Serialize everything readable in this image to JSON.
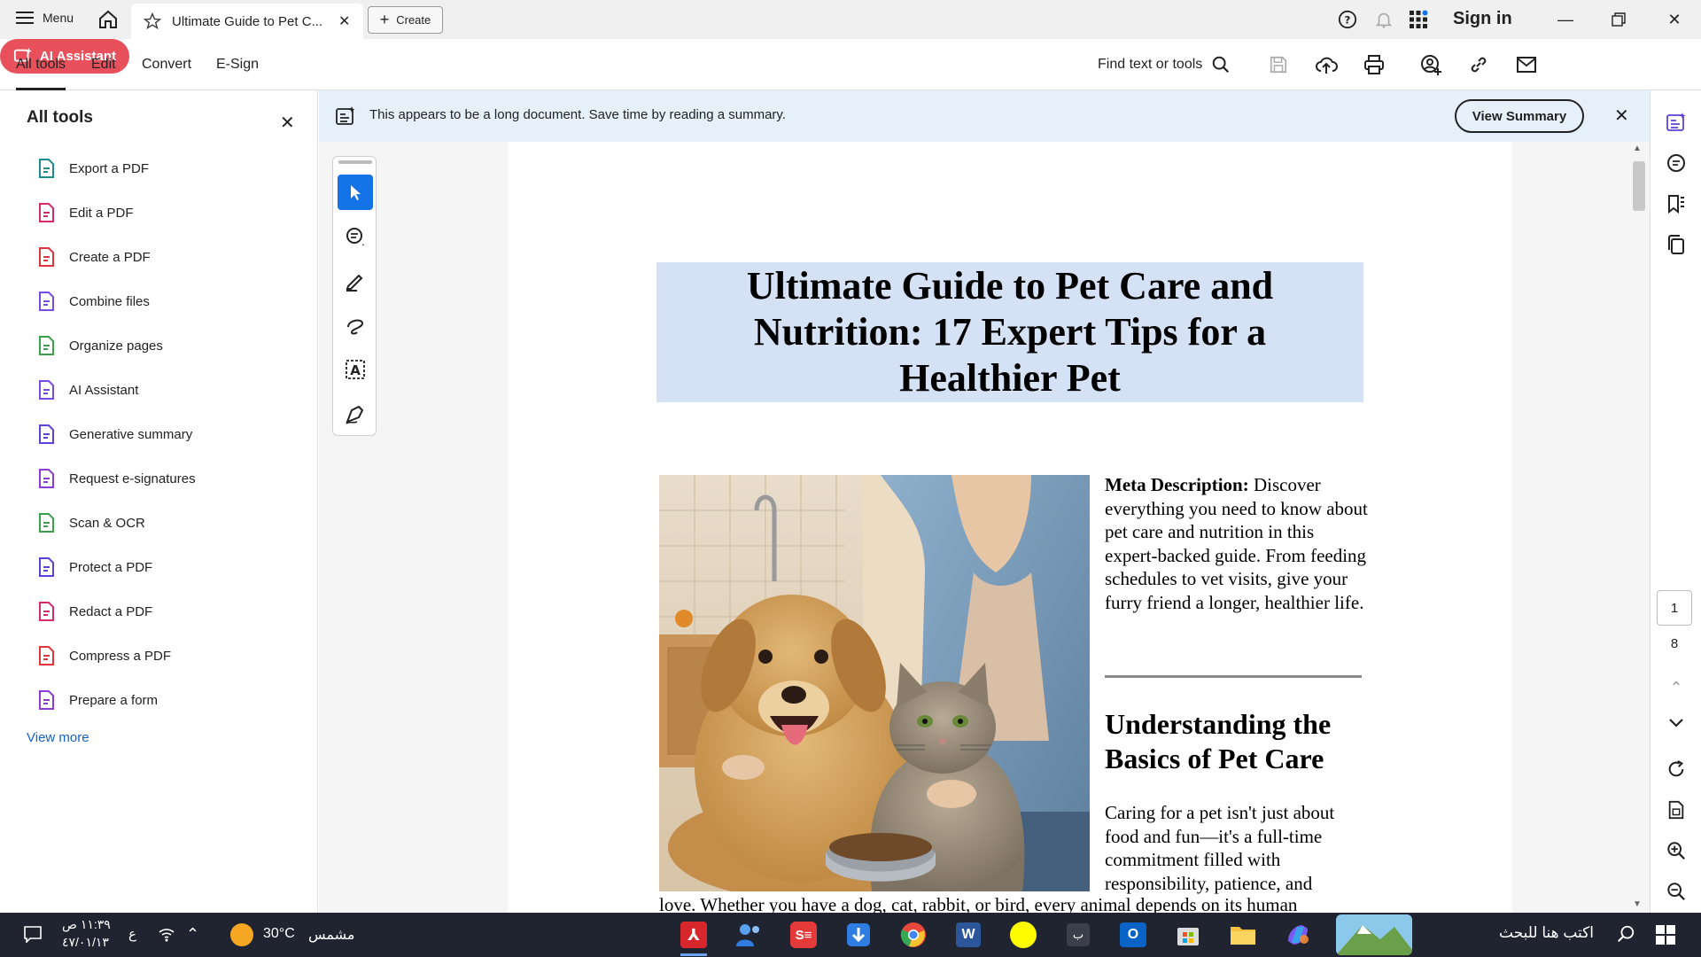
{
  "titlebar": {
    "menu_label": "Menu",
    "tab_title": "Ultimate Guide to Pet C...",
    "create_label": "Create",
    "sign_in": "Sign in"
  },
  "toolbar": {
    "menus": [
      "All tools",
      "Edit",
      "Convert",
      "E-Sign"
    ],
    "find_label": "Find text or tools",
    "ai_assistant": "AI Assistant"
  },
  "left_panel": {
    "title": "All tools",
    "items": [
      {
        "label": "Export a PDF",
        "color": "#1c8c8c"
      },
      {
        "label": "Edit a PDF",
        "color": "#d62b6b"
      },
      {
        "label": "Create a PDF",
        "color": "#e0353b"
      },
      {
        "label": "Combine files",
        "color": "#7b4ae0"
      },
      {
        "label": "Organize pages",
        "color": "#3aa14a"
      },
      {
        "label": "AI Assistant",
        "color": "#7b4ae0"
      },
      {
        "label": "Generative summary",
        "color": "#5a43d6"
      },
      {
        "label": "Request e-signatures",
        "color": "#8e3ccf"
      },
      {
        "label": "Scan & OCR",
        "color": "#3aa14a"
      },
      {
        "label": "Protect a PDF",
        "color": "#5a43d6"
      },
      {
        "label": "Redact a PDF",
        "color": "#d62b6b"
      },
      {
        "label": "Compress a PDF",
        "color": "#e0353b"
      },
      {
        "label": "Prepare a form",
        "color": "#8e3ccf"
      }
    ],
    "view_more": "View more"
  },
  "banner": {
    "text": "This appears to be a long document. Save time by reading a summary.",
    "button": "View Summary"
  },
  "document": {
    "title": "Ultimate Guide to Pet Care and Nutrition: 17 Expert Tips for a Healthier Pet",
    "meta_label": "Meta Description:",
    "meta_text": " Discover everything you need to know about pet care and nutrition in this expert-backed guide. From feeding schedules to vet visits, give your furry friend a longer, healthier life.",
    "heading": "Understanding the Basics of Pet Care",
    "paragraph": "Caring for a pet isn't just about food and fun—it's a full-time commitment filled with responsibility, patience, and",
    "paragraph_cont": "love. Whether you have a dog, cat, rabbit, or bird, every animal depends on its human"
  },
  "page_nav": {
    "current": "1",
    "total": "8"
  },
  "taskbar": {
    "time": "١١:٣٩ ص",
    "date": "٤٧/٠١/١٣",
    "lang": "ع",
    "weather_temp": "30°C",
    "weather_desc": "مشمس",
    "search_placeholder": "اكتب هنا للبحث"
  },
  "colors": {
    "accent_blue": "#1473e6",
    "ai_red": "#e8505b",
    "banner_bg": "#e6f0fb",
    "title_bg": "#d5e2f5"
  }
}
